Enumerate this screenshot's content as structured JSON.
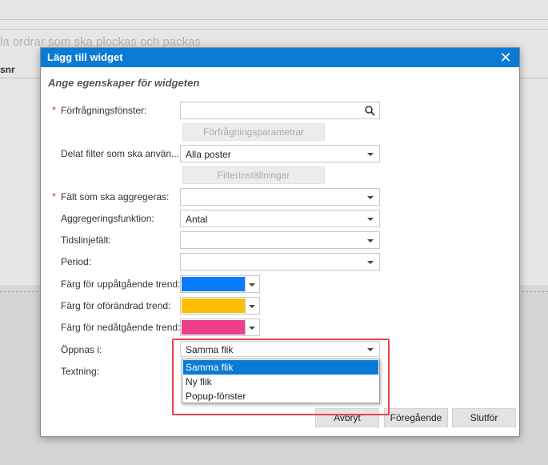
{
  "background": {
    "subtitle": "la ordrar som ska plockas och packas",
    "column_header": "snr"
  },
  "dialog": {
    "title": "Lägg till widget",
    "subtitle": "Ange egenskaper för widgeten",
    "fields": {
      "inquiry_window": {
        "label": "Förfrågningsfönster:",
        "value": ""
      },
      "inquiry_params_button": "Förfrågningsparametrar",
      "shared_filter": {
        "label": "Delat filter som ska använ...",
        "value": "Alla poster"
      },
      "filter_settings_button": "Filterinställningar",
      "aggregate_field": {
        "label": "Fält som ska aggregeras:",
        "value": ""
      },
      "aggregation_function": {
        "label": "Aggregeringsfunktion:",
        "value": "Antal"
      },
      "timeline_field": {
        "label": "Tidslinjefält:",
        "value": ""
      },
      "period": {
        "label": "Period:",
        "value": ""
      },
      "trend_up_color": {
        "label": "Färg för uppåtgående trend:",
        "color": "#0a7bff"
      },
      "trend_flat_color": {
        "label": "Färg för oförändrad trend:",
        "color": "#ffbf00"
      },
      "trend_down_color": {
        "label": "Färg för nedåtgående trend:",
        "color": "#eb3f8e"
      },
      "open_in": {
        "label": "Öppnas i:",
        "value": "Samma flik",
        "options": [
          "Samma flik",
          "Ny flik",
          "Popup-fönster"
        ],
        "selected_index": 0
      },
      "caption": {
        "label": "Textning:"
      }
    },
    "buttons": {
      "cancel": "Avbryt",
      "previous": "Föregående",
      "finish": "Slutför"
    },
    "accent_color": "#0a7bd4",
    "highlight_color": "#e6454a"
  }
}
